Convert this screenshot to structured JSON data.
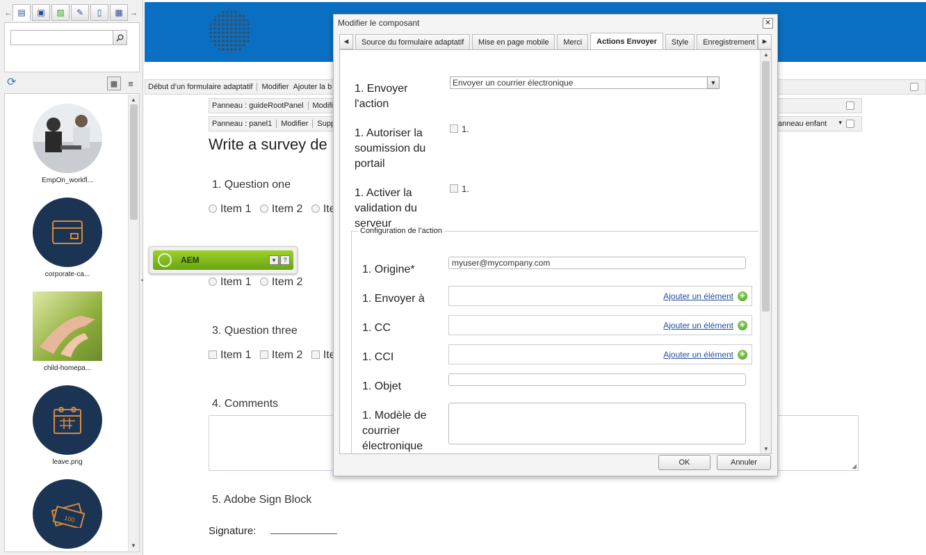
{
  "sidekick": {
    "tabs": [
      "components-icon",
      "content-icon",
      "images-icon",
      "documents-icon",
      "pages-icon",
      "grid-icon"
    ],
    "search_placeholder": "",
    "assets": [
      {
        "caption": "EmpOn_workfl...",
        "kind": "photo-people"
      },
      {
        "caption": "corporate-ca...",
        "kind": "card-icon"
      },
      {
        "caption": "child-homepa...",
        "kind": "photo-child"
      },
      {
        "caption": "leave.png",
        "kind": "calendar-icon"
      },
      {
        "caption": "",
        "kind": "money-icon"
      }
    ]
  },
  "editbar1": {
    "label1": "Début d’un formulaire adaptatif",
    "label2": "Modifier",
    "label3": "Ajouter la b"
  },
  "editbar2": {
    "label1": "Panneau : guideRootPanel",
    "label2": "Modifie"
  },
  "editbar3": {
    "label1": "Panneau : panel1",
    "label2": "Modifier",
    "label3": "Supp",
    "label_right": "anneau enfant"
  },
  "form": {
    "title": "Write a survey de",
    "q1": "1. Question one",
    "q1_items": [
      "Item 1",
      "Item 2",
      "Ite"
    ],
    "q2_items": [
      "Item 1",
      "Item 2"
    ],
    "q3": "3. Question three",
    "q3_items": [
      "Item 1",
      "Item 2",
      "Ite"
    ],
    "q4": "4. Comments",
    "q5": "5. Adobe Sign Block",
    "signature_label": "Signature:"
  },
  "aem_widget": {
    "label": "AEM",
    "help": "?"
  },
  "dialog": {
    "title": "Modifier le composant",
    "tabs": [
      "Source du formulaire adaptatif",
      "Mise en page mobile",
      "Merci",
      "Actions Envoyer",
      "Style",
      "Enregistrement a"
    ],
    "active_tab": "Actions Envoyer",
    "fields": {
      "submit_action_label_1": "1. Envoyer",
      "submit_action_label_2": "l'action",
      "submit_action_value": "Envoyer un courrier électronique",
      "portal_label": [
        "1. Autoriser la",
        "soumission du",
        "portail"
      ],
      "portal_check_text": "1.",
      "server_label": [
        "1. Activer la",
        "validation du",
        "serveur"
      ],
      "server_check_text": "1.",
      "config_legend": "Configuration de l’action",
      "from_label": "1. Origine*",
      "from_value": "myuser@mycompany.com",
      "to_label": "1. Envoyer à",
      "cc_label": "1. CC",
      "bcc_label": "1. CCI",
      "add_item": "Ajouter un élément",
      "subject_label": "1. Objet",
      "template_label": [
        "1. Modèle de",
        "courrier",
        "électronique"
      ]
    },
    "ok": "OK",
    "cancel": "Annuler"
  },
  "colors": {
    "banner": "#0a6fc2",
    "navy_thumb": "#1b3454",
    "aem_green": "#8cc21f"
  }
}
